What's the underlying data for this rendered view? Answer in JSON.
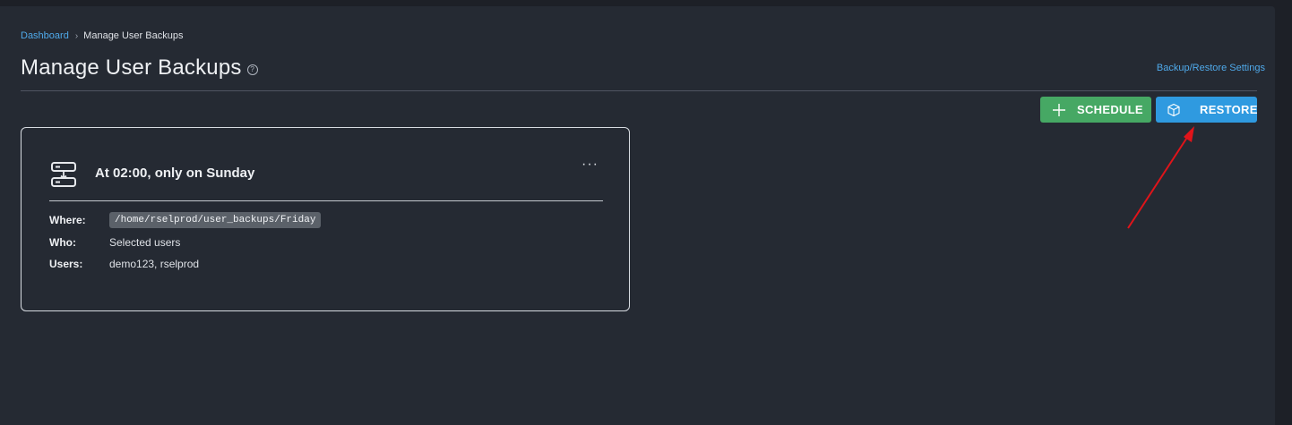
{
  "breadcrumb": {
    "home": "Dashboard",
    "separator": "›",
    "current": "Manage User Backups"
  },
  "page": {
    "title": "Manage User Backups",
    "help_icon": "question-circle-icon",
    "settings_link": "Backup/Restore Settings"
  },
  "actions": {
    "schedule_label": "SCHEDULE",
    "schedule_icon": "plus-icon",
    "schedule_color": "#46a864",
    "restore_label": "RESTORE",
    "restore_icon": "box-icon",
    "restore_color": "#2f9ae0"
  },
  "backup_card": {
    "icon": "server-download-icon",
    "title": "At 02:00, only on Sunday",
    "menu_label": "···",
    "where_label": "Where:",
    "where_value": "/home/rselprod/user_backups/Friday",
    "who_label": "Who:",
    "who_value": "Selected users",
    "users_label": "Users:",
    "users_value": "demo123, rselprod"
  },
  "annotation": {
    "arrow_color": "#e0141a"
  }
}
